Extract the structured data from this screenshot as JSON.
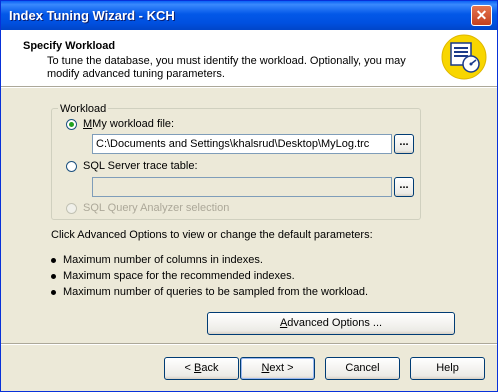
{
  "window": {
    "title": "Index Tuning Wizard - KCH",
    "close_label": "✕"
  },
  "header": {
    "title": "Specify Workload",
    "description": "To tune the database, you must identify the workload. Optionally, you may modify advanced tuning parameters.",
    "icon": "wizard-settings-icon"
  },
  "workload": {
    "group_label": "Workload",
    "options": {
      "file": {
        "label": "My workload file:",
        "selected": true,
        "value": "C:\\Documents and Settings\\khalsrud\\Desktop\\MyLog.trc"
      },
      "trace": {
        "label": "SQL Server trace table:",
        "selected": false,
        "value": ""
      },
      "analyzer": {
        "label": "SQL Query Analyzer selection",
        "selected": false,
        "enabled": false
      }
    },
    "browse_label": "..."
  },
  "instructions": "Click Advanced Options to view or change the default parameters:",
  "parameters": [
    "Maximum number of columns in indexes.",
    "Maximum space for the recommended indexes.",
    "Maximum number of queries to be sampled from the workload."
  ],
  "buttons": {
    "advanced": {
      "mnemonic": "A",
      "rest": "dvanced Options ..."
    },
    "back": {
      "prefix": "< ",
      "mnemonic": "B",
      "rest": "ack"
    },
    "next": {
      "mnemonic": "N",
      "rest": "ext >"
    },
    "cancel": "Cancel",
    "help": "Help"
  }
}
